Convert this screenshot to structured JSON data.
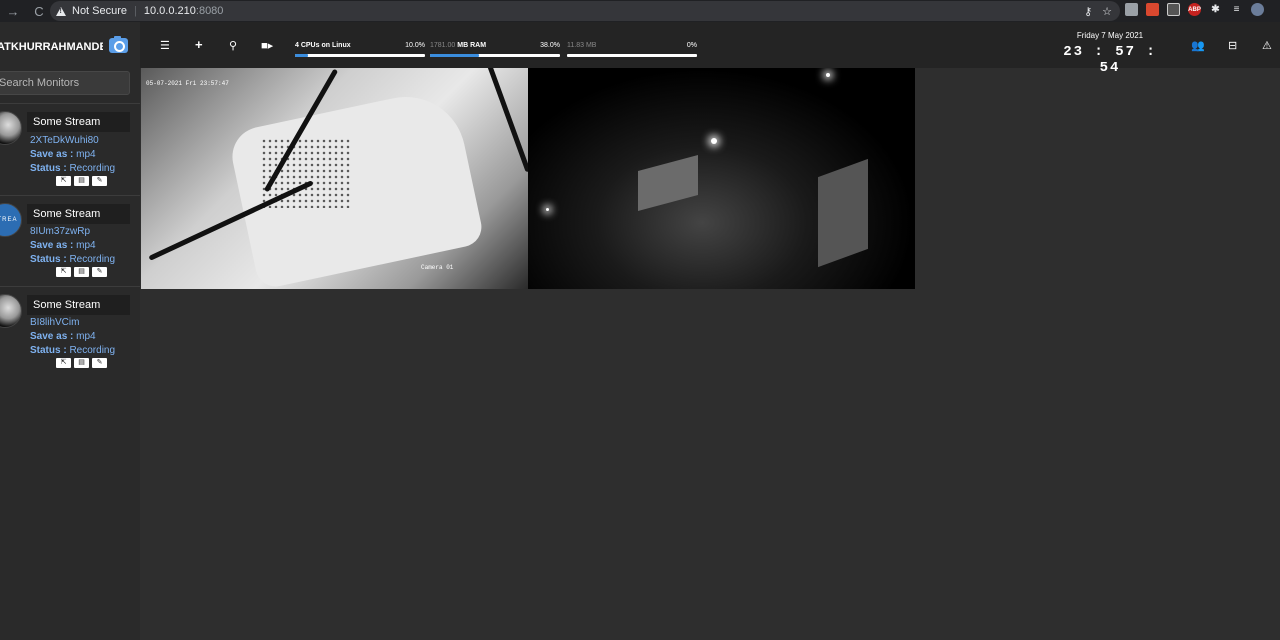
{
  "browser": {
    "nav_back": "→",
    "nav_reload": "C",
    "security_label": "Not Secure",
    "url_host": "10.0.0.210",
    "url_port": ":8080",
    "key_icon": "key-icon",
    "star_icon": "star-icon",
    "extensions": [
      {
        "name": "ext-gray",
        "color": "#9aa0a6",
        "text": ""
      },
      {
        "name": "ext-red-figure",
        "color": "#d9482f",
        "text": ""
      },
      {
        "name": "ext-window",
        "color": "#3a3a3a",
        "text": ""
      },
      {
        "name": "ext-abp",
        "color": "#c5221f",
        "text": "ABP"
      }
    ]
  },
  "sidebar": {
    "brand": "ATKHURRAHMANDEV...",
    "search_placeholder": "Search Monitors",
    "monitors": [
      {
        "name": "Some Stream",
        "id": "2XTeDkWuhi80",
        "save_label": "Save as :",
        "save_value": "mp4",
        "status_label": "Status :",
        "status_value": "Recording",
        "thumb": "photo"
      },
      {
        "name": "Some Stream",
        "id": "8IUm37zwRp",
        "save_label": "Save as :",
        "save_value": "mp4",
        "status_label": "Status :",
        "status_value": "Recording",
        "thumb": "blue",
        "thumb_text": "STREA"
      },
      {
        "name": "Some Stream",
        "id": "BI8lihVCim",
        "save_label": "Save as :",
        "save_value": "mp4",
        "status_label": "Status :",
        "status_value": "Recording",
        "thumb": "photo"
      }
    ]
  },
  "topbar": {
    "icons": [
      "list-icon",
      "plus-icon",
      "map-pin-icon",
      "video-camera-icon"
    ],
    "cpu": {
      "label": "4 CPUs on Linux",
      "percent": "10.0%",
      "fill": 0.1
    },
    "ram": {
      "value": "1781.00",
      "unit": "MB RAM",
      "percent": "38.0%",
      "fill": 0.38
    },
    "disk": {
      "value": "11.83 MB",
      "percent": "0%",
      "fill": 0
    },
    "date": "Friday 7 May 2021",
    "time": "23 : 57 : 54",
    "right_icons": [
      "users-icon",
      "drive-icon",
      "warning-icon"
    ]
  },
  "videos": [
    {
      "timestamp": "05-07-2021 Fri 23:57:47",
      "caption": "Camera 01"
    },
    {
      "timestamp": "",
      "caption": ""
    }
  ],
  "colors": {
    "accent": "#3a8dde",
    "link": "#7fb2f0",
    "sidebar_bg": "#2a2a2a",
    "topbar_bg": "#242424",
    "page_bg": "#2e2e2e"
  }
}
